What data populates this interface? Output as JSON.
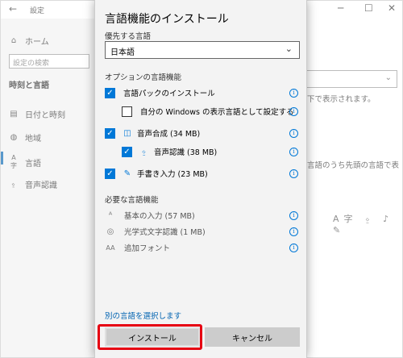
{
  "window": {
    "back_glyph": "←",
    "title": "設定",
    "minimize": "─",
    "maximize": "☐",
    "close": "✕"
  },
  "sidebar": {
    "home": "ホーム",
    "search_placeholder": "設定の検索",
    "section": "時刻と言語",
    "items": [
      {
        "label": "日付と時刻",
        "icon": "calendar-icon",
        "glyph": "▤"
      },
      {
        "label": "地域",
        "icon": "globe-icon",
        "glyph": "◍"
      },
      {
        "label": "言語",
        "icon": "language-icon",
        "glyph": "A字"
      },
      {
        "label": "音声認識",
        "icon": "microphone-icon",
        "glyph": "🎙"
      }
    ]
  },
  "background": {
    "text1": "下で表示されます。",
    "text2": "言語のうち先頭の言語で表"
  },
  "dialog": {
    "title": "言語機能のインストール",
    "preferred_label": "優先する言語",
    "preferred_value": "日本語",
    "optional_label": "オプションの言語機能",
    "optional": [
      {
        "label": "言語パックのインストール",
        "checked": true
      },
      {
        "label": "自分の Windows の表示言語として設定する",
        "checked": false
      },
      {
        "label": "音声合成 (34 MB)",
        "checked": true,
        "icon": "speech-icon"
      },
      {
        "label": "音声認識 (38 MB)",
        "checked": true,
        "icon": "microphone-icon"
      },
      {
        "label": "手書き入力 (23 MB)",
        "checked": true,
        "icon": "handwriting-icon"
      }
    ],
    "required_label": "必要な言語機能",
    "required": [
      {
        "label": "基本の入力 (57 MB)",
        "icon": "typing-icon"
      },
      {
        "label": "光学式文字認識 (1 MB)",
        "icon": "ocr-icon"
      },
      {
        "label": "追加フォント",
        "icon": "font-icon"
      }
    ],
    "link": "別の言語を選択します",
    "install": "インストール",
    "cancel": "キャンセル"
  },
  "colors": {
    "accent": "#0078d7",
    "highlight": "#e60012"
  }
}
